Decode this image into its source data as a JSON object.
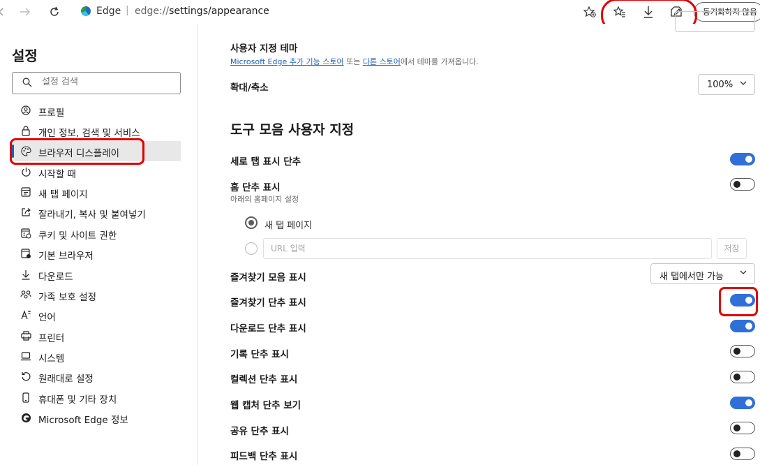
{
  "toolbar": {
    "site_label": "Edge",
    "url_prefix": "edge://",
    "url_path": "settings/appearance",
    "sync_button": "동기화하지 않음"
  },
  "sidebar": {
    "title": "설정",
    "search_placeholder": "설정 검색",
    "items": [
      {
        "label": "프로필",
        "icon": "profile-icon"
      },
      {
        "label": "개인 정보, 검색 및 서비스",
        "icon": "lock-icon"
      },
      {
        "label": "브라우저 디스플레이",
        "icon": "palette-icon",
        "active": true
      },
      {
        "label": "시작할 때",
        "icon": "power-icon"
      },
      {
        "label": "새 탭 페이지",
        "icon": "new-tab-icon"
      },
      {
        "label": "잘라내기, 복사 및 붙여넣기",
        "icon": "share-icon"
      },
      {
        "label": "쿠키 및 사이트 권한",
        "icon": "permissions-icon"
      },
      {
        "label": "기본 브라우저",
        "icon": "browser-icon"
      },
      {
        "label": "다운로드",
        "icon": "download-icon"
      },
      {
        "label": "가족 보호 설정",
        "icon": "family-icon"
      },
      {
        "label": "언어",
        "icon": "language-icon"
      },
      {
        "label": "프린터",
        "icon": "printer-icon"
      },
      {
        "label": "시스템",
        "icon": "laptop-icon"
      },
      {
        "label": "원래대로 설정",
        "icon": "reset-icon"
      },
      {
        "label": "휴대폰 및 기타 장치",
        "icon": "phone-icon"
      },
      {
        "label": "Microsoft Edge 정보",
        "icon": "edge-icon"
      }
    ]
  },
  "main": {
    "custom_theme": {
      "label": "사용자 지정 테마",
      "link1": "Microsoft Edge 추가 기능 스토어",
      "text_mid": " 또는 ",
      "link2": "다른 스토어",
      "text_end": "에서 테마를 가져옵니다."
    },
    "zoom": {
      "label": "확대/축소",
      "value": "100%"
    },
    "toolbar_section_title": "도구 모음 사용자 지정",
    "settings": [
      {
        "label": "세로 탭 표시 단추",
        "on": true
      },
      {
        "label": "홈 단추 표시",
        "sub": "아래의 홈페이지 설정",
        "on": false
      },
      {
        "label": "즐겨찾기 모음 표시",
        "dropdown": "새 탭에서만 가능"
      },
      {
        "label": "즐겨찾기 단추 표시",
        "on": true
      },
      {
        "label": "다운로드 단추 표시",
        "on": true
      },
      {
        "label": "기록 단추 표시",
        "on": false
      },
      {
        "label": "컬렉션 단추 표시",
        "on": false
      },
      {
        "label": "웹 캡처 단추 보기",
        "on": true
      },
      {
        "label": "공유 단추 표시",
        "on": false
      },
      {
        "label": "피드백 단추 표시",
        "on": false
      }
    ],
    "home_options": {
      "new_tab_label": "새 탭 페이지",
      "url_placeholder": "URL 입력",
      "save_label": "저장"
    }
  },
  "colors": {
    "accent": "#2f6fd8",
    "highlight": "#e00000",
    "link": "#1e5fb3"
  }
}
